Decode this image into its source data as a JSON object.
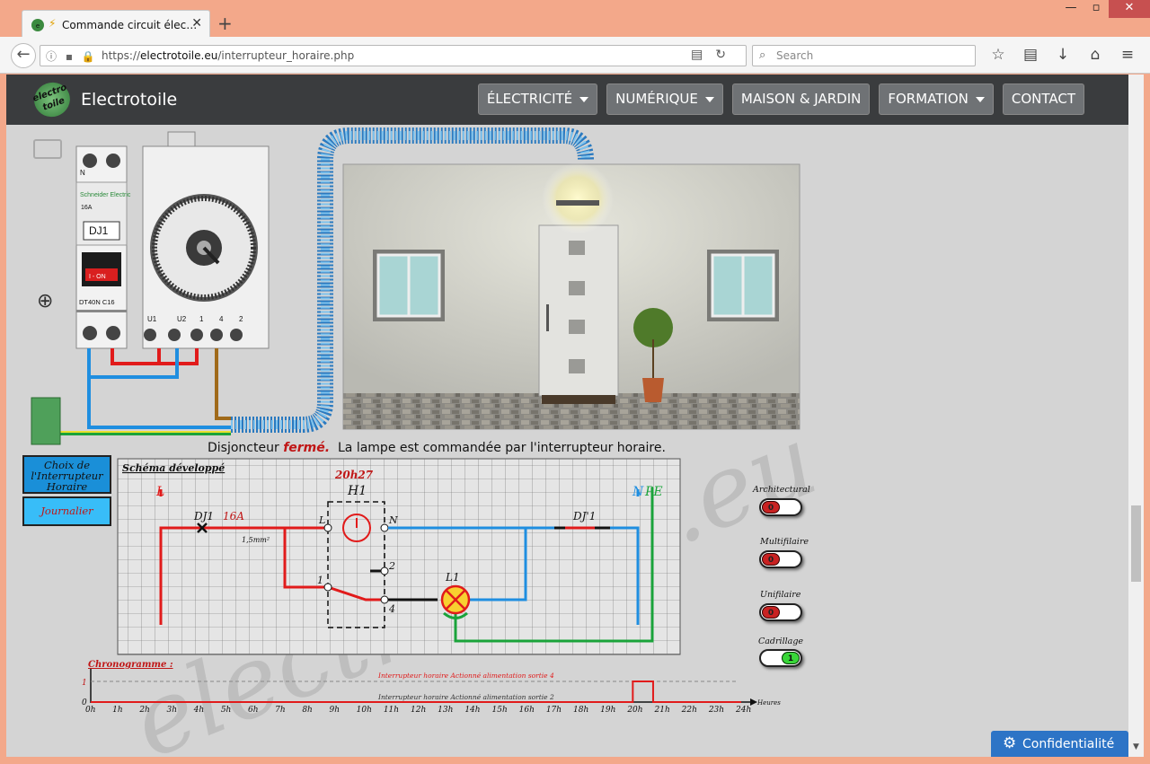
{
  "browser": {
    "tab_title": "Commande circuit élec…",
    "new_tab": "+",
    "url_domain": "electrotoile.eu",
    "url_prefix": "https://",
    "url_path": "/interrupteur_horaire.php",
    "search_placeholder": "Search"
  },
  "site": {
    "brand": "Electrotoile",
    "logo_text": "electro toile",
    "menu": [
      {
        "label": "ÉLECTRICITÉ",
        "dropdown": true
      },
      {
        "label": "NUMÉRIQUE",
        "dropdown": true
      },
      {
        "label": "MAISON & JARDIN",
        "dropdown": false
      },
      {
        "label": "FORMATION",
        "dropdown": true
      },
      {
        "label": "CONTACT",
        "dropdown": false
      }
    ],
    "confidentiality": "Confidentialité"
  },
  "scene": {
    "breaker_label": "DJ1",
    "breaker_brand": "Schneider Electric",
    "breaker_rating": "16A",
    "breaker_model": "DT40N C16",
    "breaker_switch": "I - ON",
    "breaker_terminal_n": "N",
    "timer_terminals": [
      "U1",
      "U2",
      "1",
      "4",
      "2"
    ],
    "watermark": "electrotoile.eu"
  },
  "status": {
    "prefix": "Disjoncteur",
    "state": "fermé.",
    "suffix": "La lampe est commandée par l'interrupteur horaire."
  },
  "side_buttons": {
    "choice": "Choix de l'Interrupteur Horaire",
    "mode": "Journalier"
  },
  "schema": {
    "title": "Schéma développé",
    "time": "20h27",
    "labels": {
      "L": "L",
      "DJ1": "DJ1",
      "rating": "16A",
      "section": "1,5mm²",
      "H1": "H1",
      "h1_L": "L",
      "h1_N": "N",
      "t2": "2",
      "t1": "1",
      "t4": "4",
      "L1": "L1",
      "DJ1b": "DJ'1",
      "N": "N",
      "PE": "PE"
    }
  },
  "toggles": [
    {
      "label": "Architectural",
      "state": "0",
      "on": false
    },
    {
      "label": "Multifilaire",
      "state": "0",
      "on": false
    },
    {
      "label": "Unifilaire",
      "state": "0",
      "on": false
    },
    {
      "label": "Cadrillage",
      "state": "1",
      "on": true
    }
  ],
  "chrono": {
    "title": "Chronogramme :",
    "line_high": "Interrupteur horaire Actionné alimentation sortie 4",
    "line_low": "Interrupteur horaire Actionné alimentation sortie 2",
    "y_high": "1",
    "y_low": "0",
    "unit": "Heures",
    "ticks": [
      "0h",
      "1h",
      "2h",
      "3h",
      "4h",
      "5h",
      "6h",
      "7h",
      "8h",
      "9h",
      "10h",
      "11h",
      "12h",
      "13h",
      "14h",
      "15h",
      "16h",
      "17h",
      "18h",
      "19h",
      "20h",
      "21h",
      "22h",
      "23h",
      "24h"
    ],
    "on_start_hour": 20,
    "on_end_hour": 20.75
  },
  "colors": {
    "phase": "#e11b1b",
    "neutral": "#1f8ee0",
    "earth": "#1aa33a",
    "header": "#3a3c3e",
    "menu_button": "#6f7275",
    "confid": "#2d74c6"
  }
}
